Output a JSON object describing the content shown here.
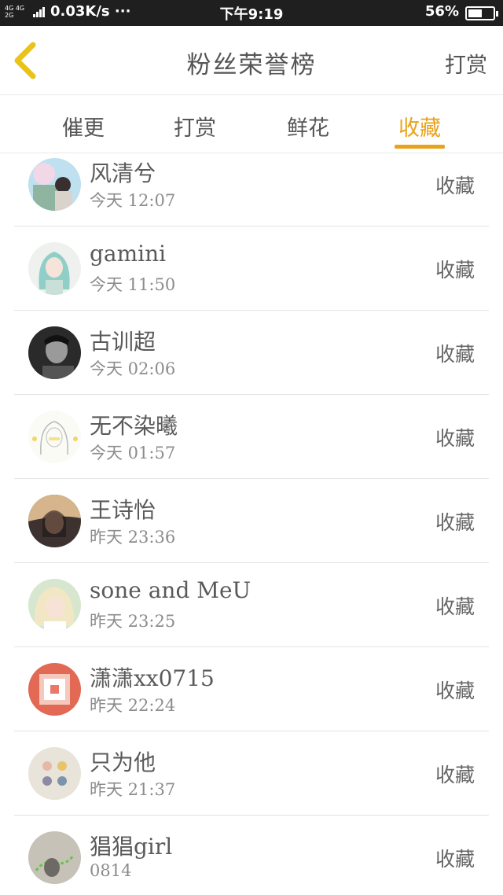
{
  "status_bar": {
    "net_top": "4G 4G",
    "net_bottom": "2G",
    "speed": "0.03K/s ···",
    "time": "下午9:19",
    "battery": "56%",
    "battery_level": 0.56
  },
  "header": {
    "title": "粉丝荣誉榜",
    "action": "打赏",
    "back_icon": "chevron-left-icon",
    "back_color": "#e9c21a"
  },
  "tabs": {
    "items": [
      {
        "label": "催更"
      },
      {
        "label": "打赏"
      },
      {
        "label": "鲜花"
      },
      {
        "label": "收藏"
      }
    ],
    "active_index": 3,
    "accent_color": "#e9a31a"
  },
  "list": {
    "items": [
      {
        "name": "风清兮",
        "time": "今天 12:07",
        "action": "收藏"
      },
      {
        "name": "gamini",
        "time": "今天 11:50",
        "action": "收藏"
      },
      {
        "name": "古训超",
        "time": "今天 02:06",
        "action": "收藏"
      },
      {
        "name": "无不染曦",
        "time": "今天 01:57",
        "action": "收藏"
      },
      {
        "name": "王诗怡",
        "time": "昨天 23:36",
        "action": "收藏"
      },
      {
        "name": "sone and MeU",
        "time": "昨天 23:25",
        "action": "收藏"
      },
      {
        "name": "潇潇xx0715",
        "time": "昨天 22:24",
        "action": "收藏"
      },
      {
        "name": "只为他",
        "time": "昨天 21:37",
        "action": "收藏"
      },
      {
        "name": "猖猖girl",
        "time": "0814",
        "action": "收藏"
      }
    ]
  }
}
